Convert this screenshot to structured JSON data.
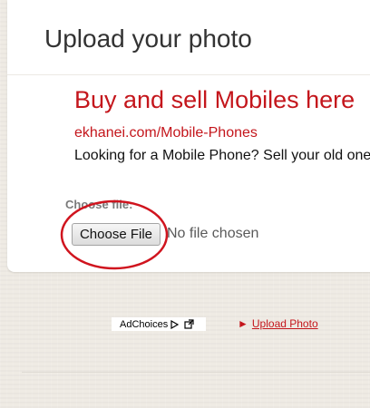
{
  "page": {
    "title": "Upload your photo"
  },
  "ad": {
    "headline": "Buy and sell Mobiles here",
    "url": "ekhanei.com/Mobile-Phones",
    "description": "Looking for a Mobile Phone? Sell your old one"
  },
  "upload_form": {
    "field_label": "Choose file:",
    "button_label": "Choose File",
    "status_text": "No file chosen"
  },
  "footer": {
    "adchoices_label": "AdChoices",
    "adchoices_icon": "triangle-play-icon",
    "adchoices_external_icon": "external-link-icon",
    "upload_link_arrow": "►",
    "upload_link_label": "Upload Photo"
  },
  "colors": {
    "accent_red": "#c4161c",
    "annotation_red": "#d0141e",
    "background": "#efebe4"
  }
}
